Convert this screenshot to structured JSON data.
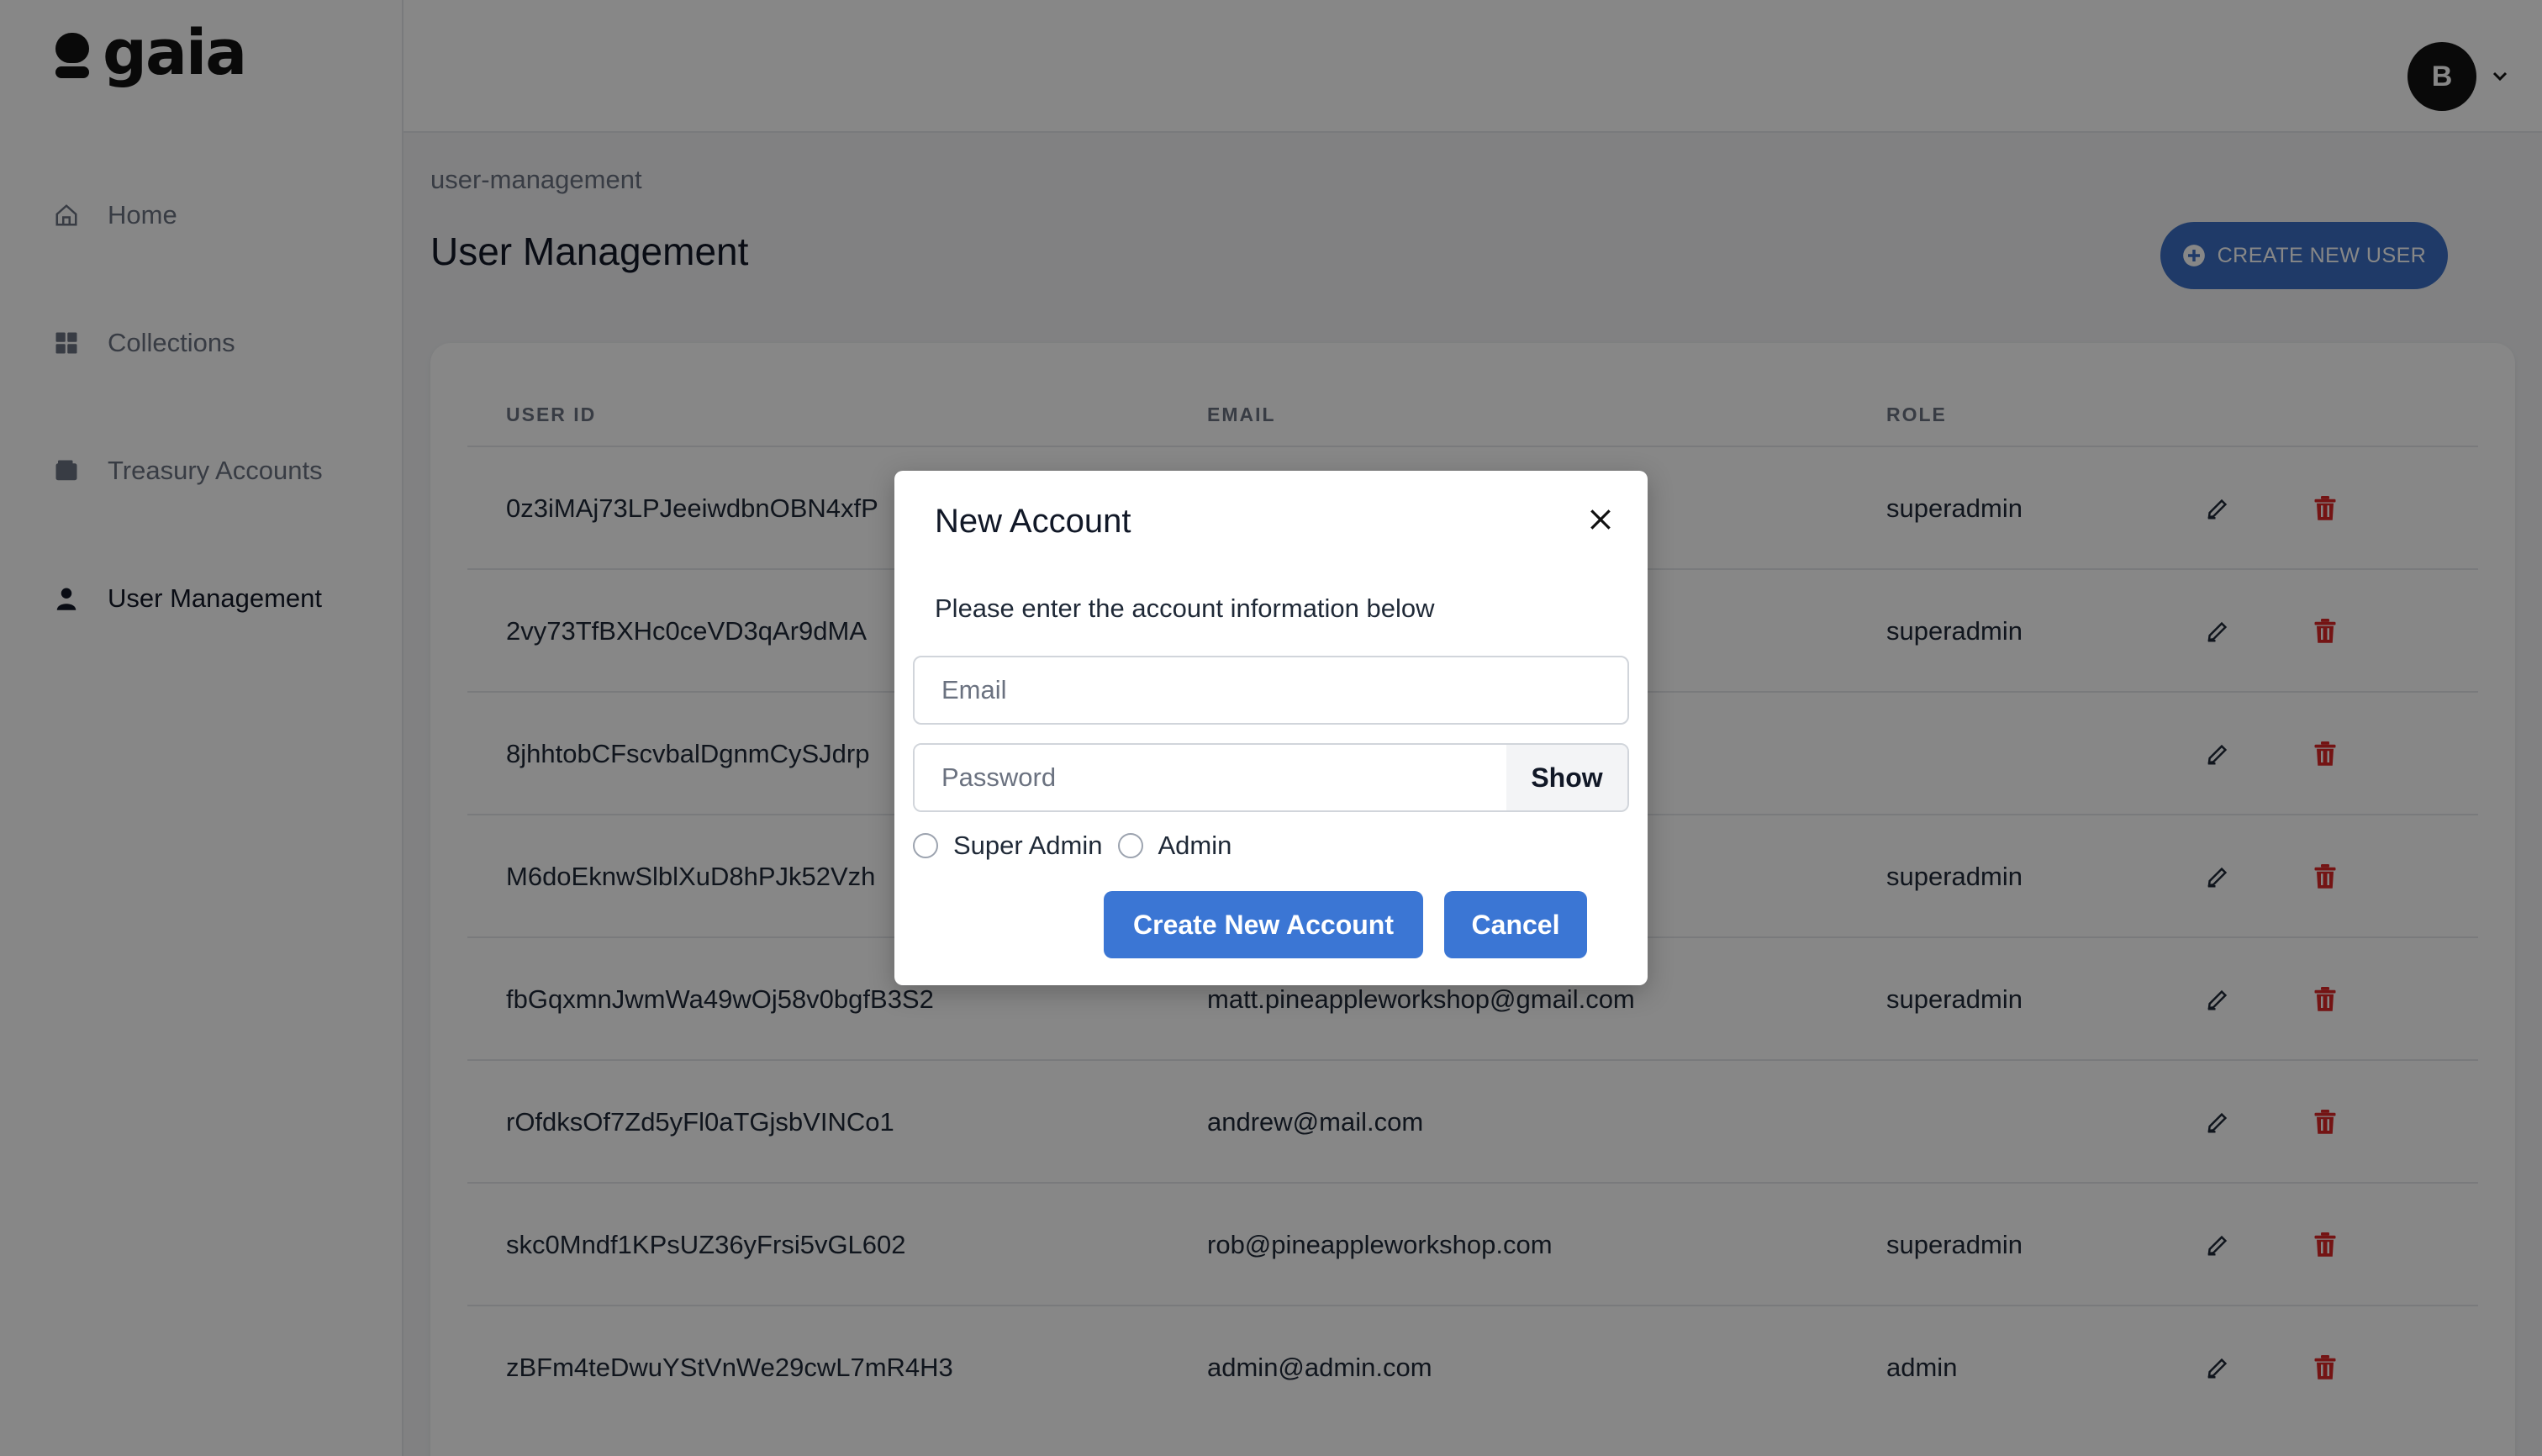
{
  "app": {
    "brand": "gaia"
  },
  "sidebar": {
    "items": [
      {
        "label": "Home",
        "icon": "home-icon",
        "active": false
      },
      {
        "label": "Collections",
        "icon": "grid-icon",
        "active": false
      },
      {
        "label": "Treasury Accounts",
        "icon": "wallet-icon",
        "active": false
      },
      {
        "label": "User Management",
        "icon": "user-icon",
        "active": true
      }
    ]
  },
  "header": {
    "avatar_initial": "B"
  },
  "page": {
    "breadcrumb": "user-management",
    "title": "User Management",
    "create_button": "CREATE NEW USER"
  },
  "table": {
    "headers": {
      "user_id": "USER ID",
      "email": "EMAIL",
      "role": "ROLE"
    },
    "rows": [
      {
        "user_id": "0z3iMAj73LPJeeiwdbnOBN4xfP",
        "email": "",
        "role": "superadmin"
      },
      {
        "user_id": "2vy73TfBXHc0ceVD3qAr9dMA",
        "email": "",
        "role": "superadmin"
      },
      {
        "user_id": "8jhhtobCFscvbalDgnmCySJdrp",
        "email": "",
        "role": ""
      },
      {
        "user_id": "M6doEknwSlblXuD8hPJk52Vzh",
        "email": "",
        "role": "superadmin"
      },
      {
        "user_id": "fbGqxmnJwmWa49wOj58v0bgfB3S2",
        "email": "matt.pineappleworkshop@gmail.com",
        "role": "superadmin"
      },
      {
        "user_id": "rOfdksOf7Zd5yFl0aTGjsbVINCo1",
        "email": "andrew@mail.com",
        "role": ""
      },
      {
        "user_id": "skc0Mndf1KPsUZ36yFrsi5vGL602",
        "email": "rob@pineappleworkshop.com",
        "role": "superadmin"
      },
      {
        "user_id": "zBFm4teDwuYStVnWe29cwL7mR4H3",
        "email": "admin@admin.com",
        "role": "admin"
      }
    ]
  },
  "modal": {
    "title": "New Account",
    "description": "Please enter the account information below",
    "email_placeholder": "Email",
    "email_value": "",
    "password_placeholder": "Password",
    "password_value": "",
    "show_label": "Show",
    "radio_super_admin": "Super Admin",
    "radio_admin": "Admin",
    "create_label": "Create New Account",
    "cancel_label": "Cancel"
  },
  "colors": {
    "primary": "#3b76d4",
    "delete": "#dc2626",
    "overlay": "rgba(0,0,0,0.47)"
  }
}
